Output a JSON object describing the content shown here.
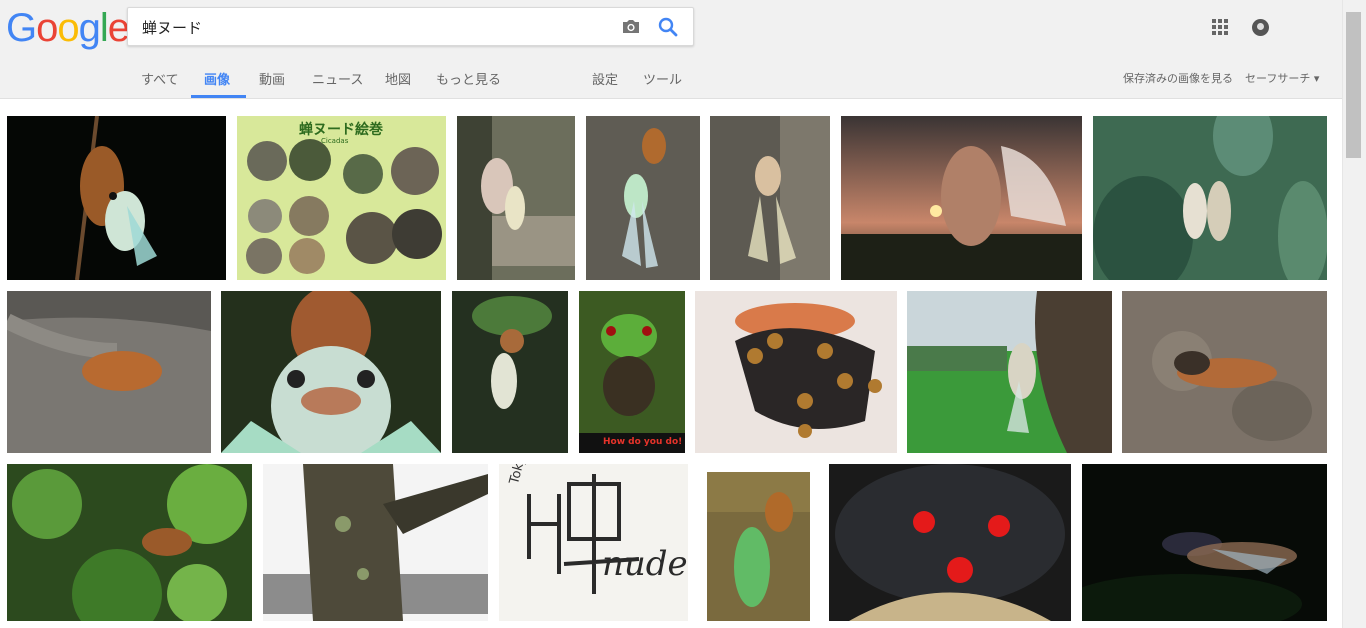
{
  "logo": {
    "letters": [
      "G",
      "o",
      "o",
      "g",
      "l",
      "e"
    ],
    "colors": [
      "#4285F4",
      "#EA4335",
      "#FBBC05",
      "#4285F4",
      "#34A853",
      "#EA4335"
    ]
  },
  "search": {
    "query": "蝉ヌード",
    "camera_icon": "camera-icon",
    "search_icon": "search-icon"
  },
  "tabs": [
    {
      "label": "すべて",
      "active": false
    },
    {
      "label": "画像",
      "active": true
    },
    {
      "label": "動画",
      "active": false
    },
    {
      "label": "ニュース",
      "active": false
    },
    {
      "label": "地図",
      "active": false
    },
    {
      "label": "もっと見る",
      "active": false
    },
    {
      "label": "設定",
      "active": false
    },
    {
      "label": "ツール",
      "active": false
    }
  ],
  "header_right": {
    "saved_images": "保存済みの画像を見る",
    "safe_search": "セーフサーチ ▾"
  },
  "accent_color": "#4285f4",
  "thumbnails": {
    "poster_title": "蝉ヌード絵巻",
    "poster_subtitle": "Cicadas",
    "how_do_you_do": "How do you do!",
    "tokyo_text": "Tokyo",
    "nude_text": "nude"
  }
}
